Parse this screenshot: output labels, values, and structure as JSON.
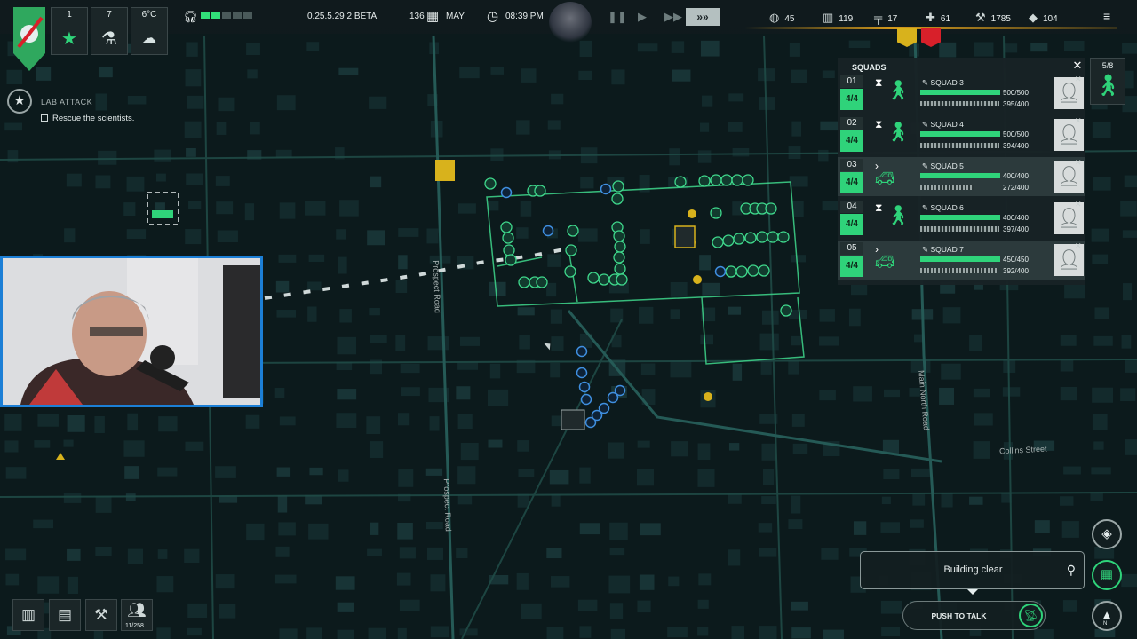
{
  "hud": {
    "stats": [
      {
        "value": "1",
        "icon": "star-icon"
      },
      {
        "value": "7",
        "icon": "microscope-icon"
      },
      {
        "value": "6°C",
        "icon": "cloud-icon"
      }
    ],
    "version": "0.25.5.29 2 BETA",
    "day": "136",
    "month": "MAY",
    "time": "08:39 PM",
    "resources": [
      {
        "icon": "intel-icon",
        "value": "45"
      },
      {
        "icon": "supplies-icon",
        "value": "119"
      },
      {
        "icon": "weapon-icon",
        "value": "17"
      },
      {
        "icon": "medkit-icon",
        "value": "61"
      },
      {
        "icon": "tools-icon",
        "value": "1785"
      },
      {
        "icon": "crates-icon",
        "value": "104"
      }
    ]
  },
  "mission": {
    "title": "LAB ATTACK",
    "objective": "Rescue the scientists."
  },
  "squads": {
    "title": "SQUADS",
    "capacity": "5/8",
    "rows": [
      {
        "id": "01",
        "count": "4/4",
        "mode": "⧗",
        "unit": "soldier",
        "name": "SQUAD 3",
        "hp": "500/500",
        "hp_frac": 1.0,
        "ammo": "395/400",
        "ammo_frac": 0.9875
      },
      {
        "id": "02",
        "count": "4/4",
        "mode": "⧗",
        "unit": "soldier",
        "name": "SQUAD 4",
        "hp": "500/500",
        "hp_frac": 1.0,
        "ammo": "394/400",
        "ammo_frac": 0.985
      },
      {
        "id": "03",
        "count": "4/4",
        "mode": "›",
        "unit": "vehicle",
        "name": "SQUAD 5",
        "hp": "400/400",
        "hp_frac": 1.0,
        "ammo": "272/400",
        "ammo_frac": 0.68
      },
      {
        "id": "04",
        "count": "4/4",
        "mode": "⧗",
        "unit": "soldier",
        "name": "SQUAD 6",
        "hp": "400/400",
        "hp_frac": 1.0,
        "ammo": "397/400",
        "ammo_frac": 0.9925
      },
      {
        "id": "05",
        "count": "4/4",
        "mode": "›",
        "unit": "vehicle",
        "name": "SQUAD 7",
        "hp": "450/450",
        "hp_frac": 1.0,
        "ammo": "392/400",
        "ammo_frac": 0.98
      }
    ]
  },
  "notification": "Building clear",
  "push_to_talk": "PUSH TO TALK",
  "compass": "N",
  "survivors": "11/258",
  "roads": [
    "Prospect Road",
    "Prospect Road",
    "Main North Road",
    "Collins Street"
  ],
  "colors": {
    "accent_green": "#2fd37a",
    "map_bg": "#0c1a1c",
    "alert_yellow": "#d8b21c",
    "alert_red": "#d8202a",
    "unit_blue": "#3f8fe0"
  }
}
